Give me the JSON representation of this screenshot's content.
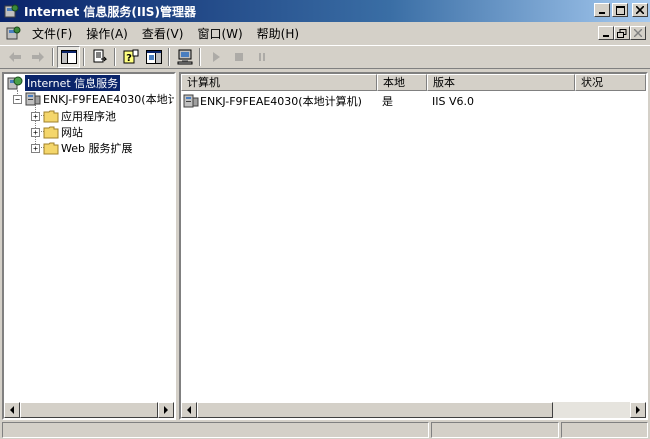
{
  "window": {
    "title": "Internet 信息服务(IIS)管理器",
    "controls": {
      "minimize": "_",
      "maximize": "□",
      "close": "✕"
    }
  },
  "menu": {
    "items": [
      "文件(F)",
      "操作(A)",
      "查看(V)",
      "窗口(W)",
      "帮助(H)"
    ]
  },
  "toolbar": {
    "buttons": [
      "back-arrow",
      "forward-arrow",
      "show-hide-tree",
      "export-list",
      "help",
      "show-hide-action-pane",
      "connect-computer",
      "start",
      "stop",
      "pause"
    ]
  },
  "tree": {
    "root": "Internet 信息服务",
    "computer": "ENKJ-F9FEAE4030(本地计",
    "children": [
      "应用程序池",
      "网站",
      "Web 服务扩展"
    ],
    "expander_collapsed": "+",
    "expander_expanded": "−"
  },
  "list": {
    "columns": [
      "计算机",
      "本地",
      "版本",
      "状况"
    ],
    "rows": [
      {
        "computer": "ENKJ-F9FEAE4030(本地计算机)",
        "local": "是",
        "version": "IIS V6.0",
        "status": ""
      }
    ]
  },
  "colors": {
    "title_gradient_start": "#0a246a",
    "title_gradient_end": "#a6caf0",
    "face": "#d4d0c8",
    "selection": "#0a246a"
  }
}
